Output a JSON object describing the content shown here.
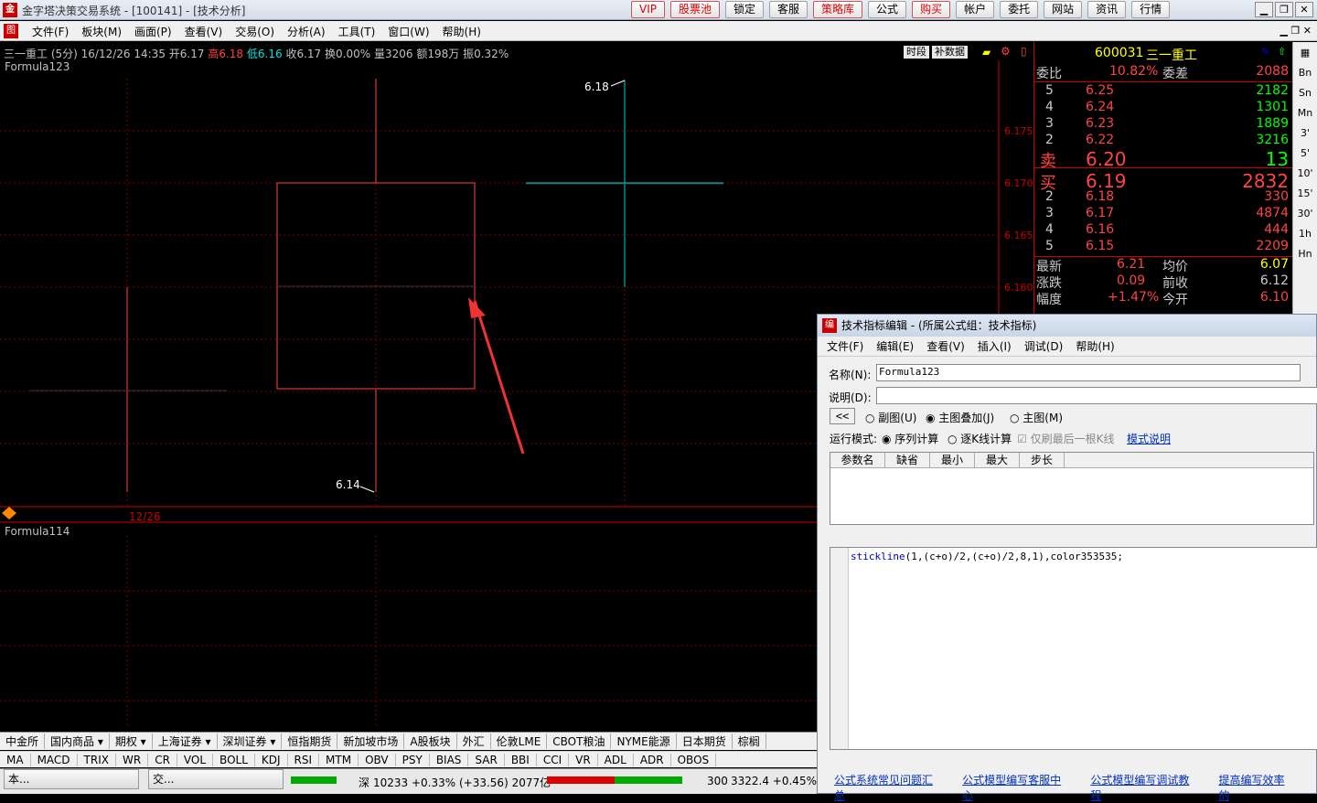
{
  "titlebar": {
    "title": "金字塔决策交易系统 - [100141] - [技术分析]",
    "buttons": [
      "VIP",
      "股票池",
      "锁定",
      "客服",
      "策略库",
      "公式",
      "购买",
      "帐户",
      "委托",
      "网站",
      "资讯",
      "行情"
    ]
  },
  "menu": {
    "items": [
      "文件(F)",
      "板块(M)",
      "画面(P)",
      "查看(V)",
      "交易(O)",
      "分析(A)",
      "工具(T)",
      "窗口(W)",
      "帮助(H)"
    ]
  },
  "chart": {
    "info": {
      "name": "三一重工 (5分)",
      "datetime": "16/12/26 14:35",
      "open": "开6.17",
      "high": "高6.18",
      "low": "低6.16",
      "close": "收6.17",
      "turnover": "换0.00%",
      "volume": "量3206",
      "amount": "额198万",
      "amplitude": "振0.32%"
    },
    "main_formula": "Formula123",
    "sub_formula": "Formula114",
    "tabs": [
      "时段",
      "补数据"
    ],
    "price_labels": [
      "6.175",
      "6.170",
      "6.165",
      "6.160"
    ],
    "high_mark": "6.18",
    "low_mark": "6.14",
    "date_label": "12/26"
  },
  "quote": {
    "code": "600031",
    "name": "三一重工",
    "weibi_label": "委比",
    "weibi": "10.82%",
    "weicha_label": "委差",
    "weicha": "2088",
    "asks": [
      {
        "level": "5",
        "price": "6.25",
        "vol": "2182"
      },
      {
        "level": "4",
        "price": "6.24",
        "vol": "1301"
      },
      {
        "level": "3",
        "price": "6.23",
        "vol": "1889"
      },
      {
        "level": "2",
        "price": "6.22",
        "vol": "3216"
      }
    ],
    "sell_label": "卖",
    "sell_price": "6.20",
    "sell_vol": "13",
    "buy_label": "买",
    "buy_price": "6.19",
    "buy_vol": "2832",
    "bids": [
      {
        "level": "2",
        "price": "6.18",
        "vol": "330"
      },
      {
        "level": "3",
        "price": "6.17",
        "vol": "4874"
      },
      {
        "level": "4",
        "price": "6.16",
        "vol": "444"
      },
      {
        "level": "5",
        "price": "6.15",
        "vol": "2209"
      }
    ],
    "stats": [
      {
        "l1": "最新",
        "v1": "6.21",
        "l2": "均价",
        "v2": "6.07"
      },
      {
        "l1": "涨跌",
        "v1": "0.09",
        "l2": "前收",
        "v2": "6.12"
      },
      {
        "l1": "幅度",
        "v1": "+1.47%",
        "l2": "今开",
        "v2": "6.10"
      }
    ]
  },
  "side_toolbar": [
    "Bn",
    "Sn",
    "Mn",
    "3'",
    "5'",
    "10'",
    "15'",
    "30'",
    "1h",
    "Hn"
  ],
  "editor": {
    "title": "技术指标编辑 - (所属公式组：技术指标)",
    "menu": [
      "文件(F)",
      "编辑(E)",
      "查看(V)",
      "插入(I)",
      "调试(D)",
      "帮助(H)"
    ],
    "name_label": "名称(N):",
    "name_value": "Formula123",
    "desc_label": "说明(D):",
    "collapse": "<<",
    "chart_options": [
      "副图(U)",
      "主图叠加(J)",
      "主图(M)"
    ],
    "run_mode_label": "运行模式:",
    "run_modes": [
      "序列计算",
      "逐K线计算"
    ],
    "last_bar": "仅刷最后一根K线",
    "mode_link": "模式说明",
    "param_headers": [
      "参数名",
      "缺省",
      "最小",
      "最大",
      "步长"
    ],
    "code_func": "stickline",
    "code_rest": "(1,(c+o)/2,(c+o)/2,8,1),color353535;",
    "links": [
      "公式系统常见问题汇总",
      "公式模型编写客服中心",
      "公式模型编写调试教程",
      "提高编写效率的"
    ]
  },
  "bottom_tabs": [
    "中金所",
    "国内商品 ▾",
    "期权 ▾",
    "上海证券 ▾",
    "深圳证券 ▾",
    "恒指期货",
    "新加坡市场",
    "A股板块",
    "外汇",
    "伦敦LME",
    "CBOT粮油",
    "NYME能源",
    "日本期货",
    "棕榈"
  ],
  "indicator_tabs": [
    "MA",
    "MACD",
    "TRIX",
    "WR",
    "CR",
    "VOL",
    "BOLL",
    "KDJ",
    "RSI",
    "MTM",
    "OBV",
    "PSY",
    "BIAS",
    "SAR",
    "BBI",
    "CCI",
    "VR",
    "ADL",
    "ADR",
    "OBOS"
  ],
  "status": {
    "tasks": [
      "本...",
      "交..."
    ],
    "sz_label": "深",
    "sz_value": "10233 +0.33% (+33.56) 2077亿",
    "hs300_label": "300",
    "hs300_value": "3322.4 +0.45%"
  }
}
